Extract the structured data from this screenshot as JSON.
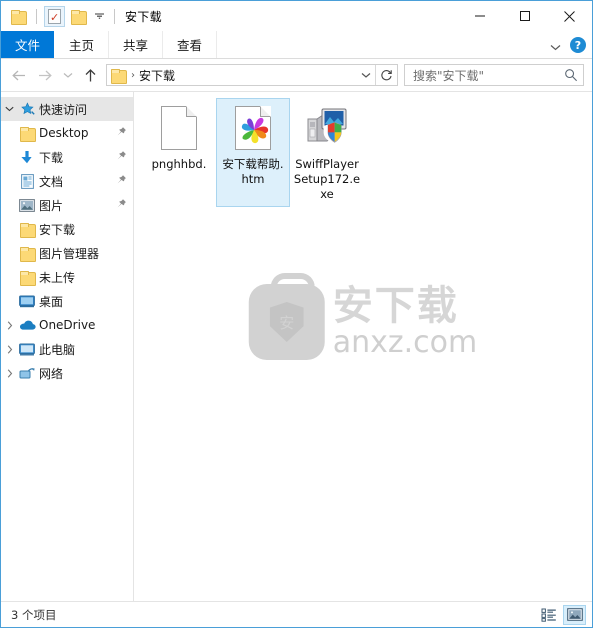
{
  "window": {
    "title": "安下载",
    "quick_access_toolbar": [
      {
        "name": "app-folder-icon",
        "icon": "folder"
      },
      {
        "name": "properties-button",
        "icon": "properties-check"
      },
      {
        "name": "new-folder-button",
        "icon": "folder"
      },
      {
        "name": "customize-qat-dropdown",
        "icon": "chevron-down"
      }
    ],
    "controls": {
      "minimize": "—",
      "maximize": "□",
      "close": "✕"
    }
  },
  "ribbon": {
    "tabs": [
      {
        "label": "文件",
        "active": true
      },
      {
        "label": "主页",
        "active": false
      },
      {
        "label": "共享",
        "active": false
      },
      {
        "label": "查看",
        "active": false
      }
    ],
    "expand_icon": "chevron-down",
    "help_label": "?"
  },
  "navigation": {
    "back_title": "后退",
    "forward_title": "前进",
    "recent_title": "最近的位置",
    "up_title": "上移一级",
    "address": {
      "crumb_separator": "›",
      "path": "安下载"
    },
    "refresh_title": "刷新",
    "search": {
      "placeholder": "搜索\"安下载\"",
      "icon": "search-icon"
    }
  },
  "sidebar": {
    "items": [
      {
        "label": "快速访问",
        "icon": "star",
        "expander": "chevron-down",
        "selected": true,
        "indent": false,
        "pinned": false
      },
      {
        "label": "Desktop",
        "icon": "folder",
        "expander": "",
        "selected": false,
        "indent": true,
        "pinned": true
      },
      {
        "label": "下载",
        "icon": "download",
        "expander": "",
        "selected": false,
        "indent": true,
        "pinned": true
      },
      {
        "label": "文档",
        "icon": "document",
        "expander": "",
        "selected": false,
        "indent": true,
        "pinned": true
      },
      {
        "label": "图片",
        "icon": "picture",
        "expander": "",
        "selected": false,
        "indent": true,
        "pinned": true
      },
      {
        "label": "安下载",
        "icon": "folder",
        "expander": "",
        "selected": false,
        "indent": true,
        "pinned": false
      },
      {
        "label": "图片管理器",
        "icon": "folder",
        "expander": "",
        "selected": false,
        "indent": true,
        "pinned": false
      },
      {
        "label": "未上传",
        "icon": "folder",
        "expander": "",
        "selected": false,
        "indent": true,
        "pinned": false
      },
      {
        "label": "桌面",
        "icon": "monitor",
        "expander": "",
        "selected": false,
        "indent": true,
        "pinned": false
      },
      {
        "label": "OneDrive",
        "icon": "cloud",
        "expander": "chevron-right",
        "selected": false,
        "indent": false,
        "pinned": false
      },
      {
        "label": "此电脑",
        "icon": "pc",
        "expander": "chevron-right",
        "selected": false,
        "indent": false,
        "pinned": false
      },
      {
        "label": "网络",
        "icon": "network",
        "expander": "chevron-right",
        "selected": false,
        "indent": false,
        "pinned": false
      }
    ]
  },
  "files": [
    {
      "name": "pnghhbd.",
      "icon": "blank-document",
      "selected": false
    },
    {
      "name": "安下载帮助.htm",
      "icon": "html-pinwheel-document",
      "selected": true
    },
    {
      "name": "SwiffPlayerSetup172.exe",
      "icon": "setup-executable",
      "selected": false
    }
  ],
  "watermark": {
    "badge_glyph": "安",
    "chinese": "安下载",
    "domain": "anxz.com"
  },
  "status": {
    "item_count_text": "3 个项目",
    "views": [
      {
        "name": "details-view-button",
        "active": false
      },
      {
        "name": "large-icons-view-button",
        "active": true
      }
    ]
  },
  "colors": {
    "accent": "#0078d7",
    "selection_fill": "#ddf0fb",
    "selection_border": "#a9d5ef",
    "window_border": "#4a9fd8",
    "help_blue": "#1e8bd4",
    "watermark_gray": "#d2d2d2"
  }
}
